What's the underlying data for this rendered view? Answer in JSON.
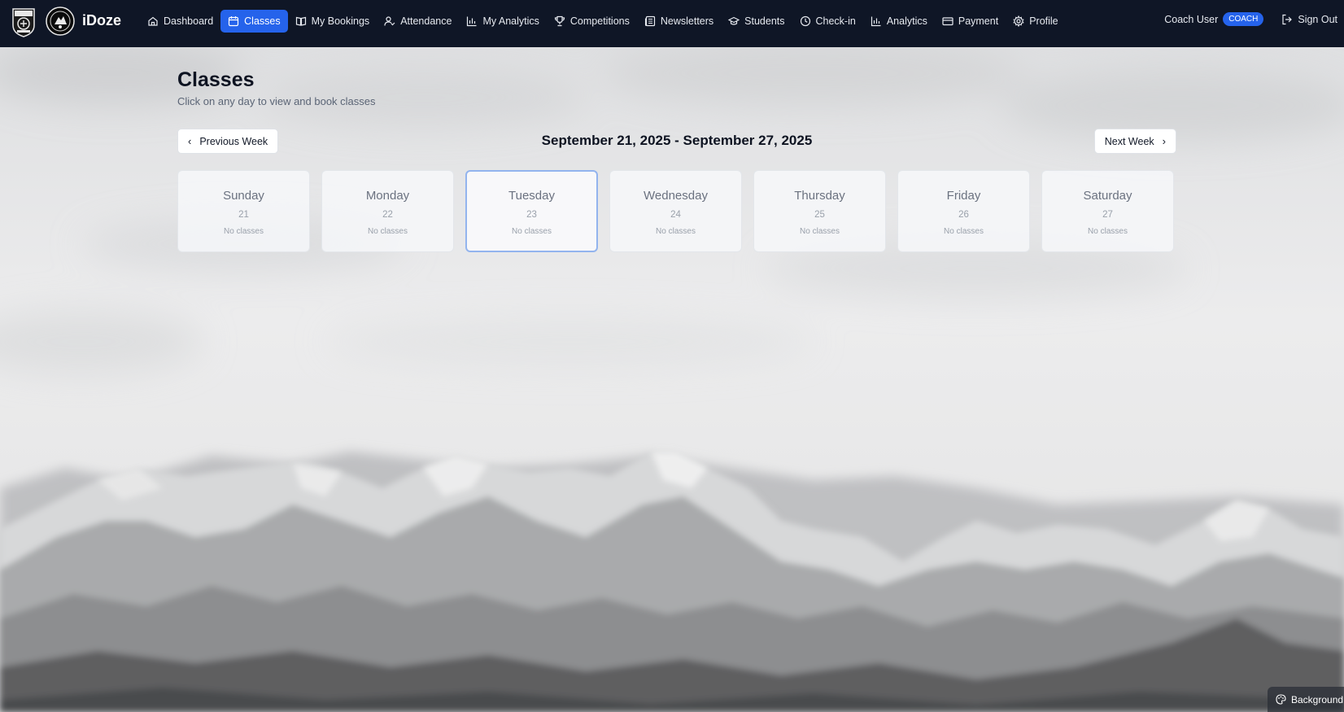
{
  "app": {
    "brand": "iDoze"
  },
  "nav": [
    {
      "label": "Dashboard",
      "icon": "home-icon",
      "active": false
    },
    {
      "label": "Classes",
      "icon": "calendar-icon",
      "active": true
    },
    {
      "label": "My Bookings",
      "icon": "book-icon",
      "active": false
    },
    {
      "label": "Attendance",
      "icon": "user-check-icon",
      "active": false
    },
    {
      "label": "My Analytics",
      "icon": "bar-chart-icon",
      "active": false
    },
    {
      "label": "Competitions",
      "icon": "trophy-icon",
      "active": false
    },
    {
      "label": "Newsletters",
      "icon": "newspaper-icon",
      "active": false
    },
    {
      "label": "Students",
      "icon": "graduation-cap-icon",
      "active": false
    },
    {
      "label": "Check-in",
      "icon": "clock-icon",
      "active": false
    },
    {
      "label": "Analytics",
      "icon": "bar-chart-icon",
      "active": false
    },
    {
      "label": "Payment",
      "icon": "credit-card-icon",
      "active": false
    },
    {
      "label": "Profile",
      "icon": "gear-icon",
      "active": false
    }
  ],
  "user": {
    "name": "Coach User",
    "role": "COACH",
    "signout": "Sign Out"
  },
  "page": {
    "title": "Classes",
    "subtitle": "Click on any day to view and book classes",
    "prev_label": "Previous Week",
    "next_label": "Next Week",
    "week_range": "September 21, 2025 - September 27, 2025"
  },
  "days": [
    {
      "name": "Sunday",
      "date": "21",
      "status": "No classes",
      "selected": false
    },
    {
      "name": "Monday",
      "date": "22",
      "status": "No classes",
      "selected": false
    },
    {
      "name": "Tuesday",
      "date": "23",
      "status": "No classes",
      "selected": true
    },
    {
      "name": "Wednesday",
      "date": "24",
      "status": "No classes",
      "selected": false
    },
    {
      "name": "Thursday",
      "date": "25",
      "status": "No classes",
      "selected": false
    },
    {
      "name": "Friday",
      "date": "26",
      "status": "No classes",
      "selected": false
    },
    {
      "name": "Saturday",
      "date": "27",
      "status": "No classes",
      "selected": false
    }
  ],
  "background_button": {
    "label": "Background",
    "icon": "palette-icon"
  },
  "colors": {
    "navbar": "#0f1626",
    "accent": "#2563eb"
  }
}
